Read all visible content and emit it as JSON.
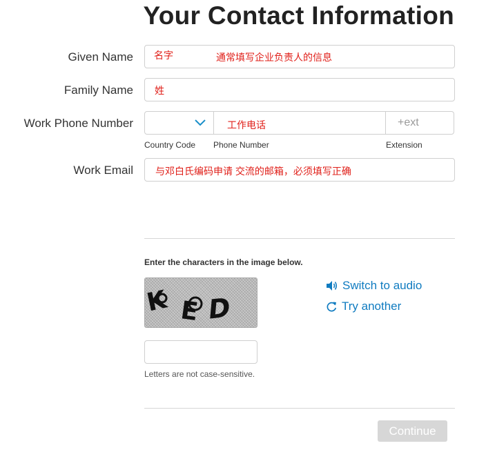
{
  "page": {
    "title": "Your Contact Information"
  },
  "form": {
    "given_name": {
      "label": "Given Name",
      "annotation_left": "名字",
      "annotation_right": "通常填写企业负责人的信息"
    },
    "family_name": {
      "label": "Family Name",
      "annotation": "姓"
    },
    "work_phone": {
      "label": "Work Phone Number",
      "country_code_label": "Country Code",
      "phone_number_label": "Phone Number",
      "phone_annotation": "工作电话",
      "extension_placeholder": "+ext",
      "extension_label": "Extension"
    },
    "work_email": {
      "label": "Work Email",
      "annotation": "与邓白氏编码申请 交流的邮箱，必须填写正确"
    }
  },
  "captcha": {
    "instruction": "Enter the characters in the image below.",
    "image_text": "KED",
    "switch_audio_label": "Switch to audio",
    "try_another_label": "Try another",
    "hint": "Letters are not case-sensitive."
  },
  "actions": {
    "continue_label": "Continue"
  },
  "colors": {
    "annotation": "#e0201a",
    "link": "#0f7bc0",
    "button_disabled": "#d7d7d7",
    "border": "#cfcfcf"
  }
}
